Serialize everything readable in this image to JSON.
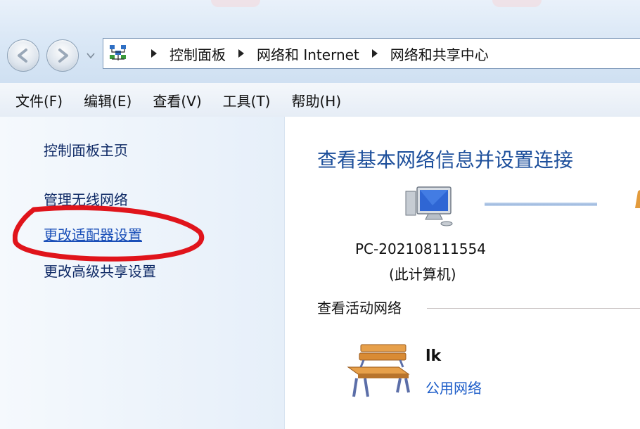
{
  "address_bar": {
    "breadcrumbs": [
      "控制面板",
      "网络和 Internet",
      "网络和共享中心"
    ]
  },
  "menu": [
    "文件(F)",
    "编辑(E)",
    "查看(V)",
    "工具(T)",
    "帮助(H)"
  ],
  "sidebar": {
    "items": [
      {
        "label": "控制面板主页"
      },
      {
        "label": "管理无线网络"
      },
      {
        "label": "更改适配器设置"
      },
      {
        "label": "更改高级共享设置"
      }
    ]
  },
  "main": {
    "title": "查看基本网络信息并设置连接",
    "computer": {
      "name": "PC-202108111554",
      "subtitle": "(此计算机)"
    },
    "active_networks": {
      "heading": "查看活动网络",
      "network": {
        "name": "lk",
        "type": "公用网络"
      }
    }
  },
  "icons": {
    "back": "back-arrow-icon",
    "forward": "forward-arrow-icon",
    "recent": "chevron-down-icon",
    "address": "network-and-sharing-center-icon",
    "computer": "computer-monitor-icon",
    "network": "park-bench-icon"
  },
  "colors": {
    "link": "#0f2a66",
    "title": "#1d4f9b",
    "network_type": "#1a5bc8",
    "annotation": "#e0141b"
  }
}
